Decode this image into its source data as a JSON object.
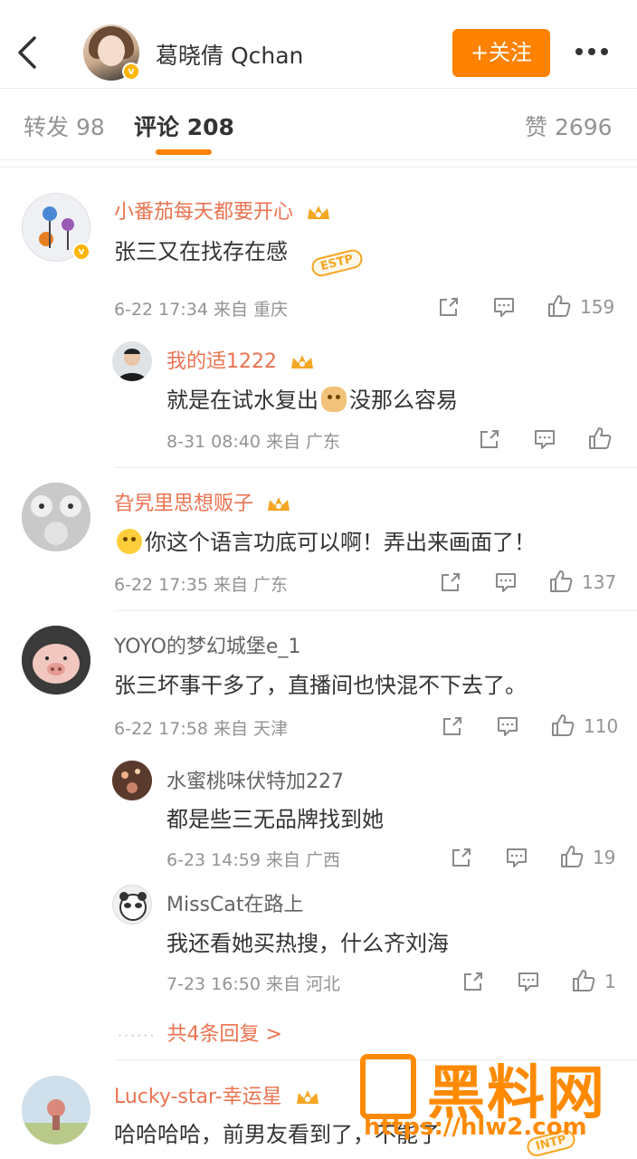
{
  "header": {
    "name": "葛晓倩 Qchan",
    "follow_label": "+关注"
  },
  "tabs": {
    "repost_label": "转发",
    "repost_count": "98",
    "comment_label": "评论",
    "comment_count": "208",
    "like_label": "赞",
    "like_count": "2696"
  },
  "comments": [
    {
      "user": "小番茄每天都要开心",
      "text": "张三又在找存在感",
      "sticker": "ESTP",
      "time": "6-22 17:34",
      "source": "来自 重庆",
      "likes": "159"
    },
    {
      "user": "我的适1222",
      "text_a": "就是在试水复出",
      "text_b": "没那么容易",
      "time": "8-31 08:40",
      "source": "来自 广东",
      "likes": ""
    },
    {
      "user": "旮旯里思想贩子",
      "text": "你这个语言功底可以啊！弄出来画面了！",
      "time": "6-22 17:35",
      "source": "来自 广东",
      "likes": "137"
    },
    {
      "user": "YOYO的梦幻城堡e_1",
      "text": "张三坏事干多了，直播间也快混不下去了。",
      "time": "6-22 17:58",
      "source": "来自 天津",
      "likes": "110"
    },
    {
      "user": "水蜜桃味伏特加227",
      "text": "都是些三无品牌找到她",
      "time": "6-23 14:59",
      "source": "来自 广西",
      "likes": "19"
    },
    {
      "user": "MissCat在路上",
      "text": "我还看她买热搜，什么齐刘海",
      "time": "7-23 16:50",
      "source": "来自 河北",
      "likes": "1"
    },
    {
      "user": "Lucky-star-幸运星",
      "text": "哈哈哈哈，前男友看到了，不能了",
      "sticker": "INTP"
    }
  ],
  "more_replies": "共4条回复 >",
  "watermark": {
    "title": "黑料网",
    "url": "https://hlw2.com"
  }
}
